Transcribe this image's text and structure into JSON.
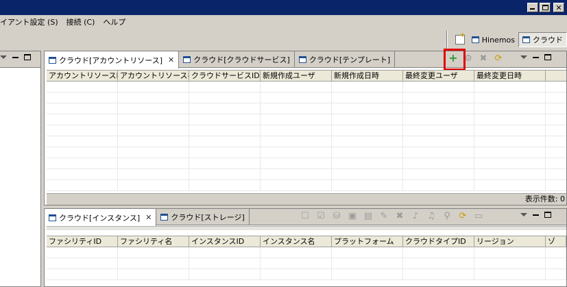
{
  "menubar": {
    "items": [
      "イアント設定 (S)",
      "接続 (C)",
      "ヘルプ"
    ]
  },
  "perspectives": {
    "items": [
      {
        "label": "Hinemos",
        "active": false
      },
      {
        "label": "クラウド",
        "active": true
      }
    ]
  },
  "top_view": {
    "tabs": [
      {
        "label": "クラウド[アカウントリソース]",
        "active": true,
        "closable": true
      },
      {
        "label": "クラウド[クラウドサービス]",
        "active": false,
        "closable": false
      },
      {
        "label": "クラウド[テンプレート]",
        "active": false,
        "closable": false
      }
    ],
    "toolbar_icons": [
      "add-icon",
      "settings-icon",
      "delete-icon",
      "refresh-icon"
    ],
    "columns": [
      "アカウントリソースID",
      "アカウントリソース名",
      "クラウドサービスID",
      "新規作成ユーザ",
      "新規作成日時",
      "最終変更ユーザ",
      "最終変更日時"
    ],
    "footer": "表示件数: 0"
  },
  "bottom_view": {
    "tabs": [
      {
        "label": "クラウド[インスタンス]",
        "active": true,
        "closable": true
      },
      {
        "label": "クラウド[ストレージ]",
        "active": false,
        "closable": false
      }
    ],
    "columns": [
      "ファシリティID",
      "ファシリティ名",
      "インスタンスID",
      "インスタンス名",
      "プラットフォーム",
      "クラウドタイプID",
      "リージョン",
      "ゾ"
    ]
  },
  "colors": {
    "titlebar": "#0a246a",
    "highlight": "#e00000",
    "add": "#2e9b2e"
  }
}
